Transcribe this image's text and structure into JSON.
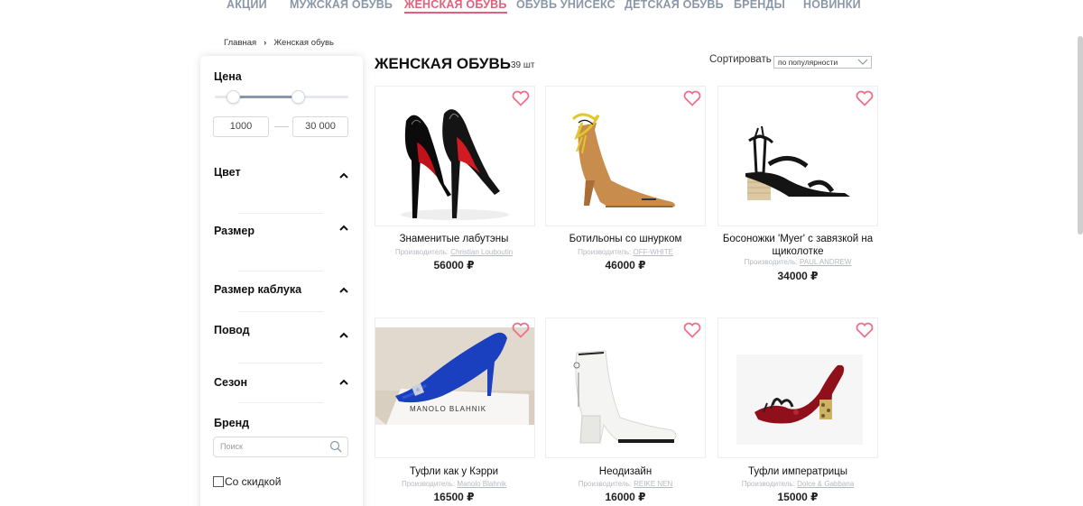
{
  "nav": {
    "items": [
      "АКЦИИ",
      "МУЖСКАЯ ОБУВЬ",
      "ЖЕНСКАЯ ОБУВЬ",
      "ОБУВЬ УНИСЕКС",
      "ДЕТСКАЯ ОБУВЬ",
      "БРЕНДЫ",
      "НОВИНКИ"
    ],
    "active": "ЖЕНСКАЯ ОБУВЬ"
  },
  "breadcrumb": {
    "home": "Главная",
    "sep": "›",
    "current": "Женская обувь"
  },
  "filters": {
    "price_title": "Цена",
    "price_min": "1000",
    "price_max": "30 000",
    "color": "Цвет",
    "size": "Размер",
    "heel_size": "Размер каблука",
    "occasion": "Повод",
    "season": "Сезон",
    "brand": "Бренд",
    "brand_placeholder": "Поиск",
    "discount": "Со скидкой"
  },
  "header": {
    "title": "ЖЕНСКАЯ ОБУВЬ",
    "count": "39 шт",
    "sort_label": "Сортировать",
    "sort_value": "по популярности"
  },
  "products": [
    {
      "name": "Знаменитые лабутэны",
      "maker_label": "Производитель:",
      "maker": "Christian Louboutin",
      "price": "56000 ₽"
    },
    {
      "name": "Ботильоны со шнурком",
      "maker_label": "Производитель:",
      "maker": "OFF-WHITE",
      "price": "46000 ₽"
    },
    {
      "name": "Босоножки 'Myer' с завязкой на щиколотке",
      "maker_label": "Производитель:",
      "maker": "PAUL ANDREW",
      "price": "34000 ₽"
    },
    {
      "name": "Туфли как у Кэрри",
      "maker_label": "Производитель:",
      "maker": "Manolo Blahnik",
      "price": "16500 ₽"
    },
    {
      "name": "Неодизайн",
      "maker_label": "Производитель:",
      "maker": "REIKE NEN",
      "price": "16000 ₽"
    },
    {
      "name": "Туфли императрицы",
      "maker_label": "Производитель:",
      "maker": "Dolce & Gabbana",
      "price": "15000 ₽"
    }
  ],
  "image_text": {
    "box_brand": "MANOLO BLAHNIK"
  },
  "colors": {
    "accent": "#e0607d",
    "nav": "#8a97a8",
    "heart": "#f0708a"
  }
}
